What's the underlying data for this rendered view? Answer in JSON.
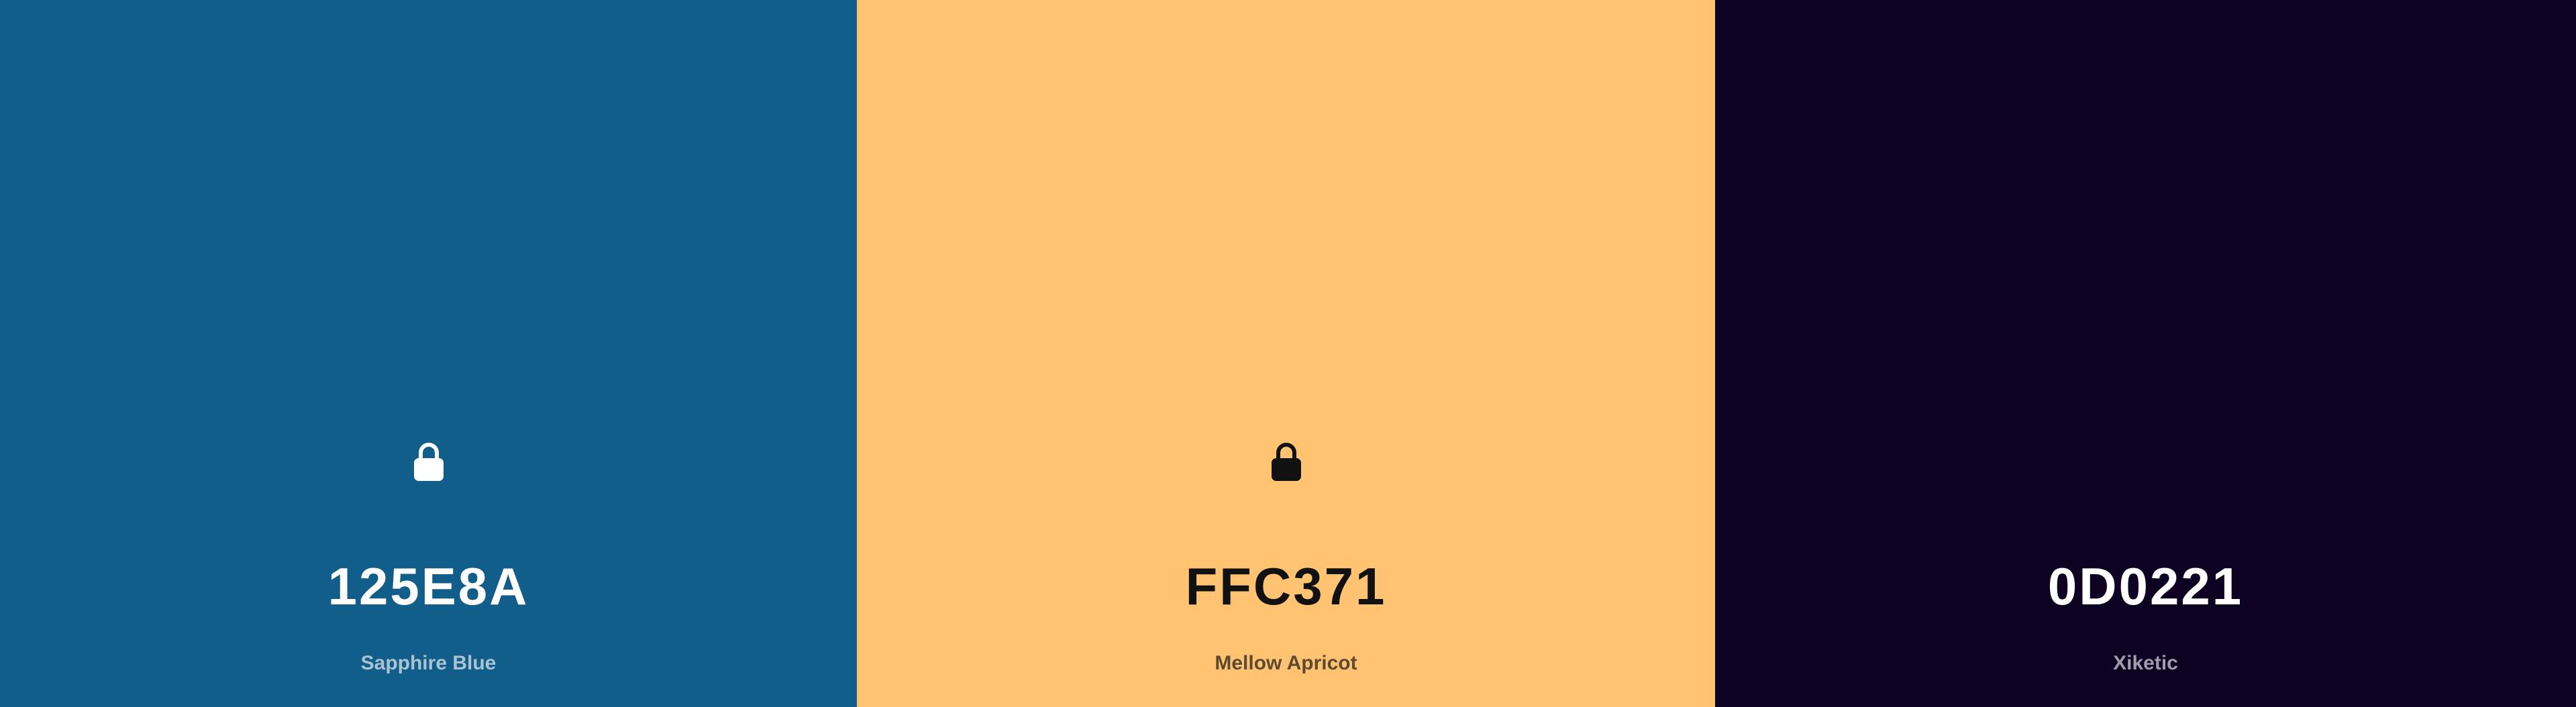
{
  "palette": {
    "colors": [
      {
        "hex": "125E8A",
        "name": "Sapphire Blue",
        "background": "#125E8A",
        "text_color": "#FFFFFF",
        "name_color": "#A9C3D2",
        "locked": true,
        "icon": "lock-icon"
      },
      {
        "hex": "FFC371",
        "name": "Mellow Apricot",
        "background": "#FFC371",
        "text_color": "#111111",
        "name_color": "#5E4A2E",
        "locked": true,
        "icon": "lock-icon"
      },
      {
        "hex": "0D0221",
        "name": "Xiketic",
        "background": "#0D0221",
        "text_color": "#FFFFFF",
        "name_color": "#A09CAB",
        "locked": false,
        "icon": null
      }
    ]
  }
}
